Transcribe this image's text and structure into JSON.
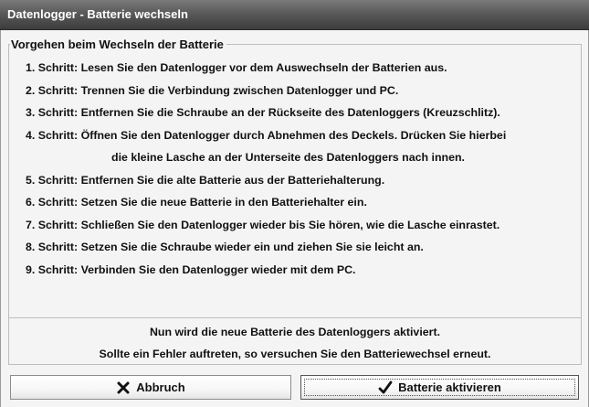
{
  "window": {
    "title": "Datenlogger - Batterie wechseln"
  },
  "group": {
    "legend": "Vorgehen beim Wechseln der Batterie",
    "steps": [
      "1. Schritt: Lesen Sie den Datenlogger vor dem Auswechseln der Batterien aus.",
      "2. Schritt: Trennen Sie die Verbindung zwischen Datenlogger und PC.",
      "3. Schritt: Entfernen Sie die Schraube an der Rückseite des Datenloggers (Kreuzschlitz).",
      "4. Schritt: Öffnen Sie den Datenlogger durch Abnehmen des Deckels. Drücken Sie hierbei",
      "die kleine Lasche an der Unterseite des Datenloggers nach innen.",
      "5. Schritt: Entfernen Sie die alte Batterie aus der Batteriehalterung.",
      "6. Schritt: Setzen Sie die neue Batterie in den Batteriehalter ein.",
      "7. Schritt: Schließen Sie den Datenlogger wieder bis Sie hören, wie die Lasche einrastet.",
      "8. Schritt: Setzen Sie die Schraube wieder ein und ziehen Sie sie leicht an.",
      "9. Schritt: Verbinden Sie den Datenlogger wieder mit dem PC."
    ]
  },
  "info": {
    "line1": "Nun wird die neue Batterie des Datenloggers aktiviert.",
    "line2": "Sollte ein Fehler auftreten, so versuchen Sie den Batteriewechsel erneut."
  },
  "buttons": {
    "cancel_label": "Abbruch",
    "cancel_icon": "x-icon",
    "ok_label": "Batterie aktivieren",
    "ok_icon": "checkmark-icon"
  }
}
